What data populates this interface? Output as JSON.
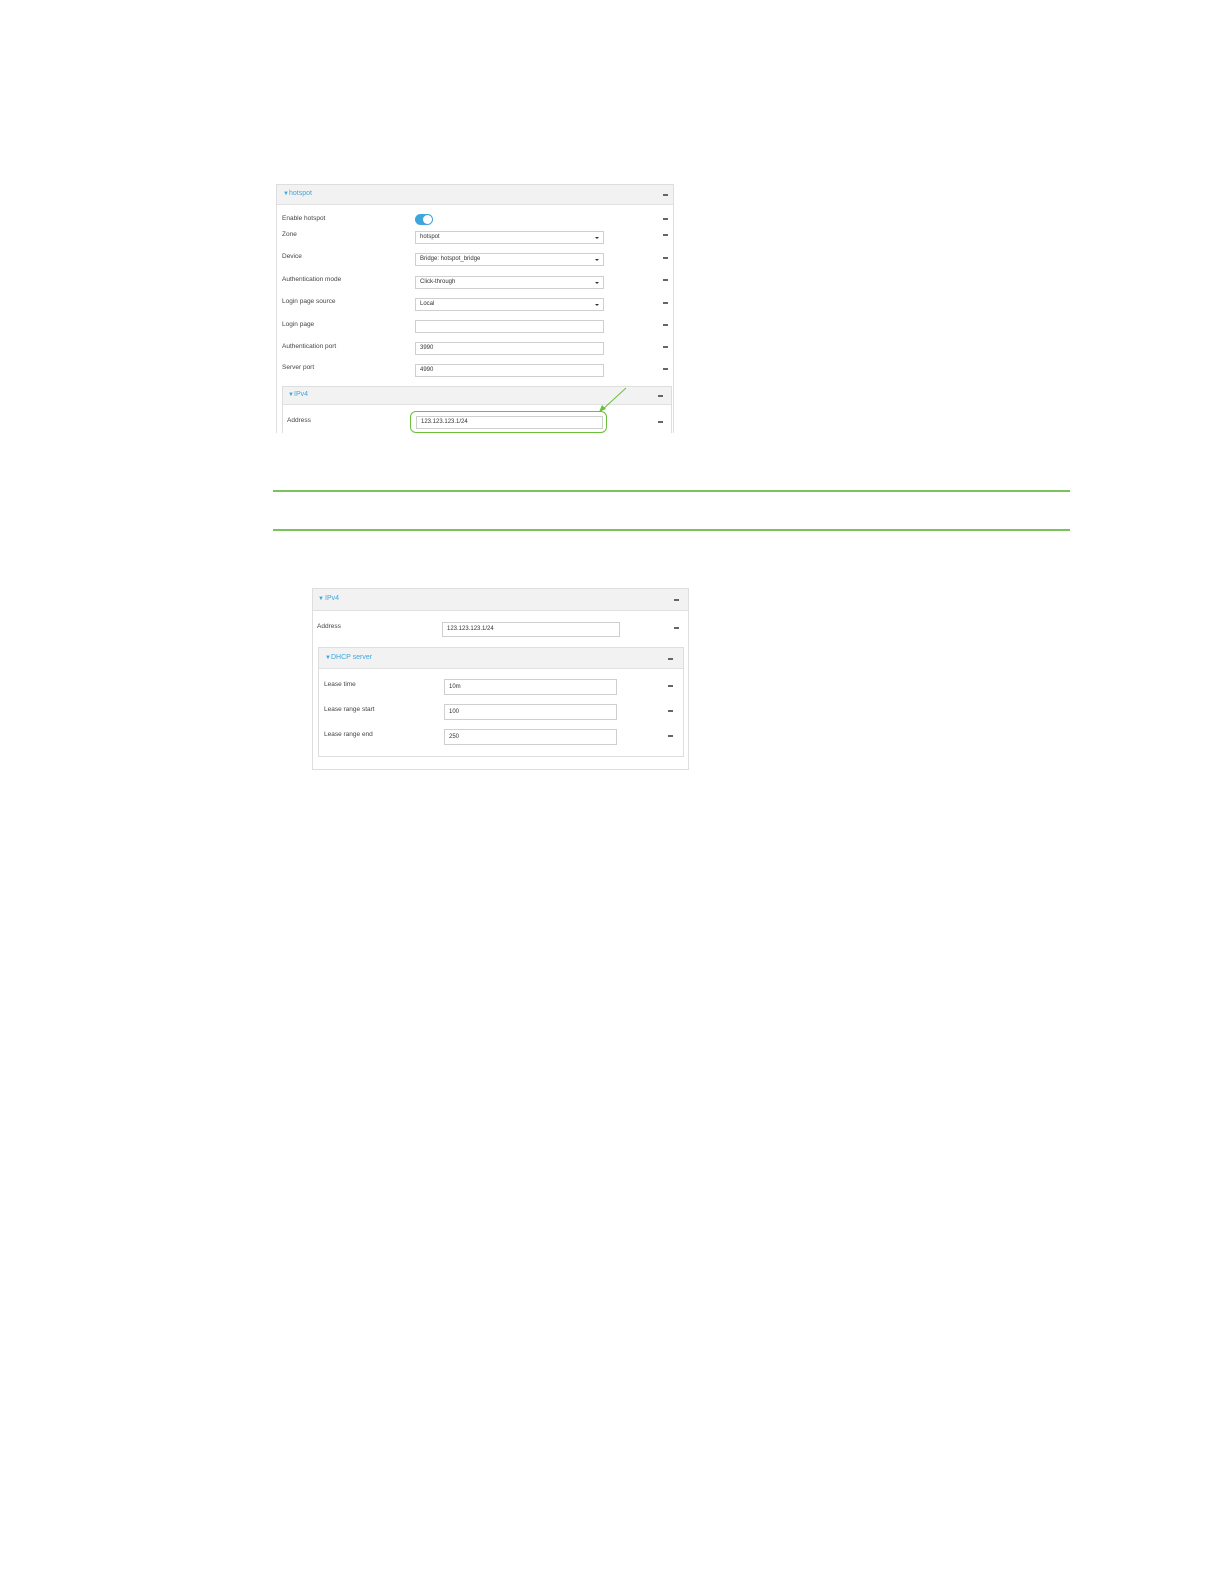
{
  "hotspot_panel": {
    "title": "hotspot",
    "fields": [
      {
        "label": "Enable hotspot",
        "type": "toggle",
        "value": "on"
      },
      {
        "label": "Zone",
        "type": "select",
        "value": "hotspot"
      },
      {
        "label": "Device",
        "type": "select",
        "value": "Bridge: hotspot_bridge"
      },
      {
        "label": "Authentication mode",
        "type": "select",
        "value": "Click-through"
      },
      {
        "label": "Login page source",
        "type": "select",
        "value": "Local"
      },
      {
        "label": "Login page",
        "type": "text",
        "value": ""
      },
      {
        "label": "Authentication port",
        "type": "text",
        "value": "3990"
      },
      {
        "label": "Server port",
        "type": "text",
        "value": "4990"
      }
    ],
    "ipv4": {
      "title": "IPv4",
      "address_label": "Address",
      "address_value": "123.123.123.1/24"
    }
  },
  "ipv4_panel": {
    "title": "IPv4",
    "address_label": "Address",
    "address_value": "123.123.123.1/24",
    "dhcp": {
      "title": "DHCP server",
      "fields": [
        {
          "label": "Lease time",
          "value": "10m"
        },
        {
          "label": "Lease range start",
          "value": "100"
        },
        {
          "label": "Lease range end",
          "value": "250"
        }
      ]
    }
  },
  "colors": {
    "accent": "#3ea6dd",
    "highlight": "#6bbf3a",
    "rule": "#7cc25a"
  },
  "icons": [
    "caret-down-icon",
    "collapse-dash-icon",
    "dropdown-arrow-icon",
    "arrow-annotation-icon"
  ]
}
